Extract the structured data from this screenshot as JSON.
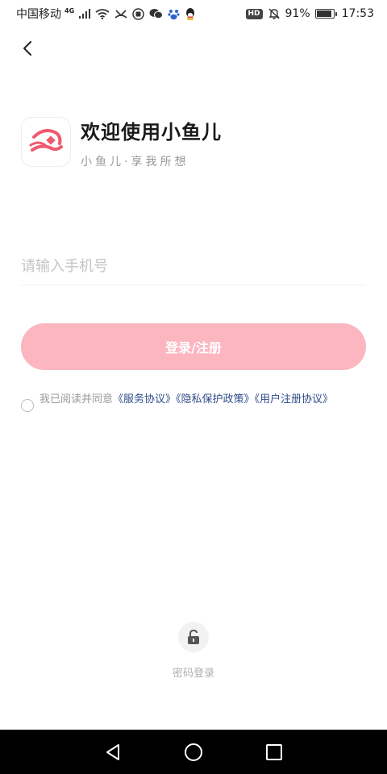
{
  "status_bar": {
    "carrier": "中国移动",
    "network": "4G",
    "battery_percent": "91%",
    "battery_level": 0.91,
    "time": "17:53",
    "hd_label": "HD",
    "icons": [
      "signal-icon",
      "wifi-icon",
      "missed-call-icon",
      "app-notification-icon",
      "wechat-icon",
      "baidu-icon",
      "qq-icon",
      "mute-icon",
      "battery-icon"
    ]
  },
  "header": {
    "back_icon": "chevron-left-icon",
    "title": "欢迎使用小鱼儿",
    "subtitle": "小鱼儿·享我所想",
    "logo_color": "#ef5a6f"
  },
  "form": {
    "phone_placeholder": "请输入手机号",
    "phone_value": "",
    "login_button_label": "登录/注册",
    "button_color": "#fbb6c0"
  },
  "agreement": {
    "prefix": "我已阅读并同意",
    "service": "《服务协议》",
    "privacy": "《隐私保护政策》",
    "user_reg": "《用户注册协议》",
    "checked": false,
    "link_color": "#2f4b8a"
  },
  "password_login": {
    "label": "密码登录",
    "icon": "lock-icon"
  },
  "nav_bar": {
    "icons": [
      "back-triangle-icon",
      "home-circle-icon",
      "recents-square-icon"
    ]
  }
}
